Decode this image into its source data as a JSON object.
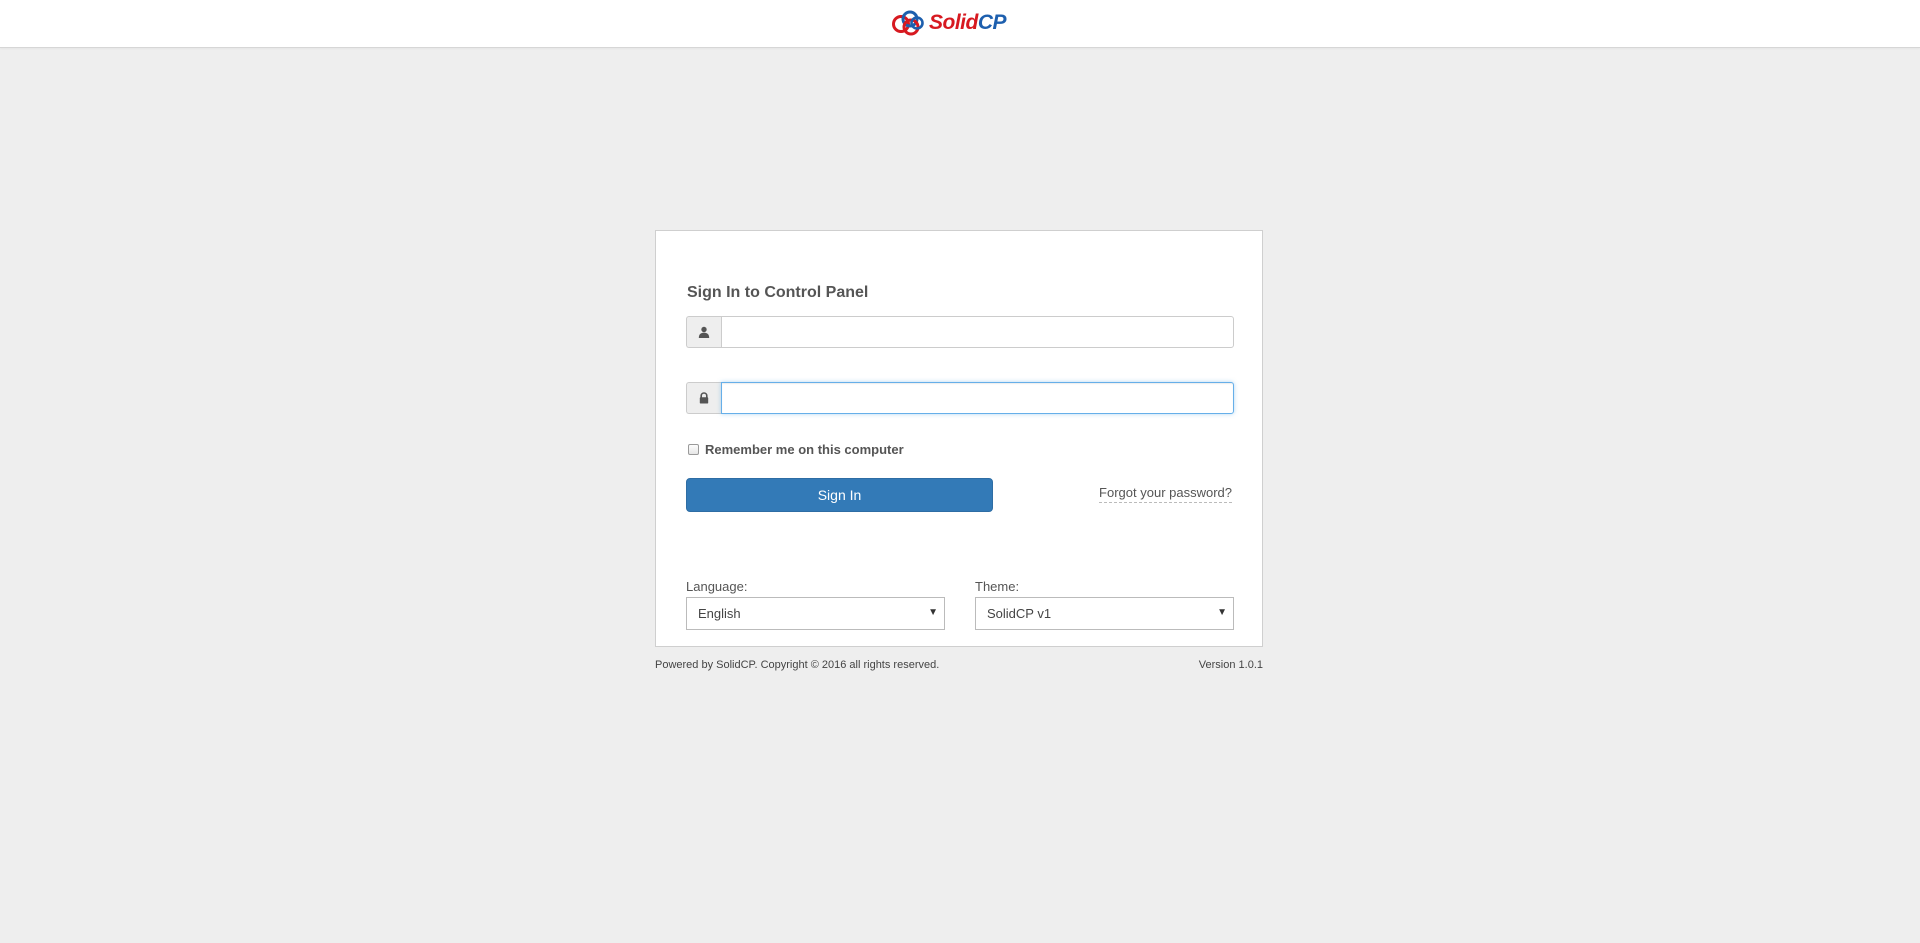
{
  "header": {
    "logo_text_part1": "Solid",
    "logo_text_part2": "CP",
    "brand_colors": {
      "red": "#d71920",
      "blue": "#1d5fae"
    }
  },
  "login": {
    "title": "Sign In to Control Panel",
    "username": {
      "value": "",
      "icon": "user-icon"
    },
    "password": {
      "value": "",
      "icon": "lock-icon"
    },
    "remember_label": "Remember me on this computer",
    "signin_label": "Sign In",
    "forgot_label": "Forgot your password?",
    "accent_color": "#337ab7"
  },
  "settings": {
    "language_label": "Language:",
    "language_value": "English",
    "theme_label": "Theme:",
    "theme_value": "SolidCP v1"
  },
  "footer": {
    "copyright": "Powered by SolidCP. Copyright © 2016 all rights reserved.",
    "version": "Version 1.0.1"
  }
}
